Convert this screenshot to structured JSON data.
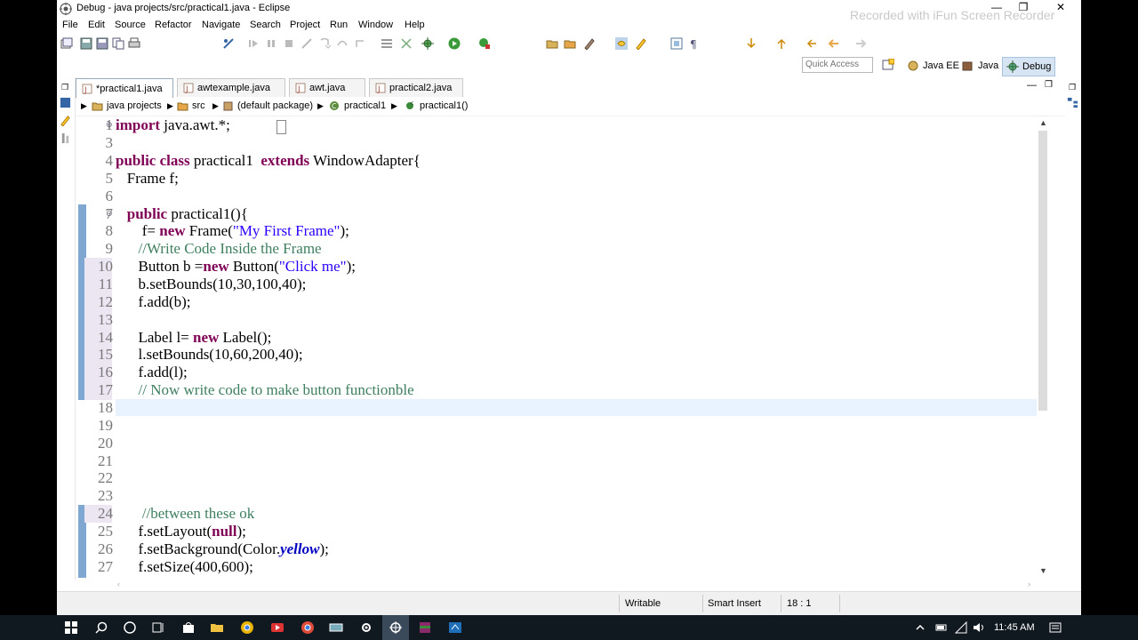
{
  "window": {
    "title": "Debug - java projects/src/practical1.java - Eclipse",
    "watermark": "Recorded with iFun Screen Recorder"
  },
  "menu": [
    "File",
    "Edit",
    "Source",
    "Refactor",
    "Navigate",
    "Search",
    "Project",
    "Run",
    "Window",
    "Help"
  ],
  "quick_access": {
    "placeholder": "Quick Access"
  },
  "perspectives": [
    {
      "label": "Java EE",
      "active": false
    },
    {
      "label": "Java",
      "active": false
    },
    {
      "label": "Debug",
      "active": true
    }
  ],
  "tabs": [
    {
      "label": "*practical1.java",
      "active": true
    },
    {
      "label": "awtexample.java",
      "active": false
    },
    {
      "label": "awt.java",
      "active": false
    },
    {
      "label": "practical2.java",
      "active": false
    }
  ],
  "breadcrumb": [
    "java projects",
    "src",
    "(default package)",
    "practical1",
    "practical1()"
  ],
  "code_lines": [
    {
      "n": "1",
      "text": "import java.awt.*;"
    },
    {
      "n": "3",
      "text": ""
    },
    {
      "n": "4",
      "text": "public class practical1  extends WindowAdapter{"
    },
    {
      "n": "5",
      "text": "   Frame f;"
    },
    {
      "n": "6",
      "text": ""
    },
    {
      "n": "7",
      "text": "   public practical1(){"
    },
    {
      "n": "8",
      "text": "       f= new Frame(\"My First Frame\");"
    },
    {
      "n": "9",
      "text": "      //Write Code Inside the Frame"
    },
    {
      "n": "10",
      "text": "      Button b =new Button(\"Click me\");"
    },
    {
      "n": "11",
      "text": "      b.setBounds(10,30,100,40);"
    },
    {
      "n": "12",
      "text": "      f.add(b);"
    },
    {
      "n": "13",
      "text": ""
    },
    {
      "n": "14",
      "text": "      Label l= new Label();"
    },
    {
      "n": "15",
      "text": "      l.setBounds(10,60,200,40);"
    },
    {
      "n": "16",
      "text": "      f.add(l);"
    },
    {
      "n": "17",
      "text": "      // Now write code to make button functionble"
    },
    {
      "n": "18",
      "text": ""
    },
    {
      "n": "19",
      "text": ""
    },
    {
      "n": "20",
      "text": ""
    },
    {
      "n": "21",
      "text": ""
    },
    {
      "n": "22",
      "text": ""
    },
    {
      "n": "23",
      "text": ""
    },
    {
      "n": "24",
      "text": "       //between these ok"
    },
    {
      "n": "25",
      "text": "      f.setLayout(null);"
    },
    {
      "n": "26",
      "text": "      f.setBackground(Color.yellow);"
    },
    {
      "n": "27",
      "text": "      f.setSize(400,600);"
    }
  ],
  "status": {
    "writable": "Writable",
    "insert_mode": "Smart Insert",
    "position": "18 : 1"
  },
  "taskbar": {
    "time": "11:45 AM"
  },
  "colors": {
    "keyword": "#7f0055",
    "string": "#2a00ff",
    "comment": "#3f7f5f",
    "static_field": "#0000c0",
    "current_line": "#e8f2fe"
  }
}
